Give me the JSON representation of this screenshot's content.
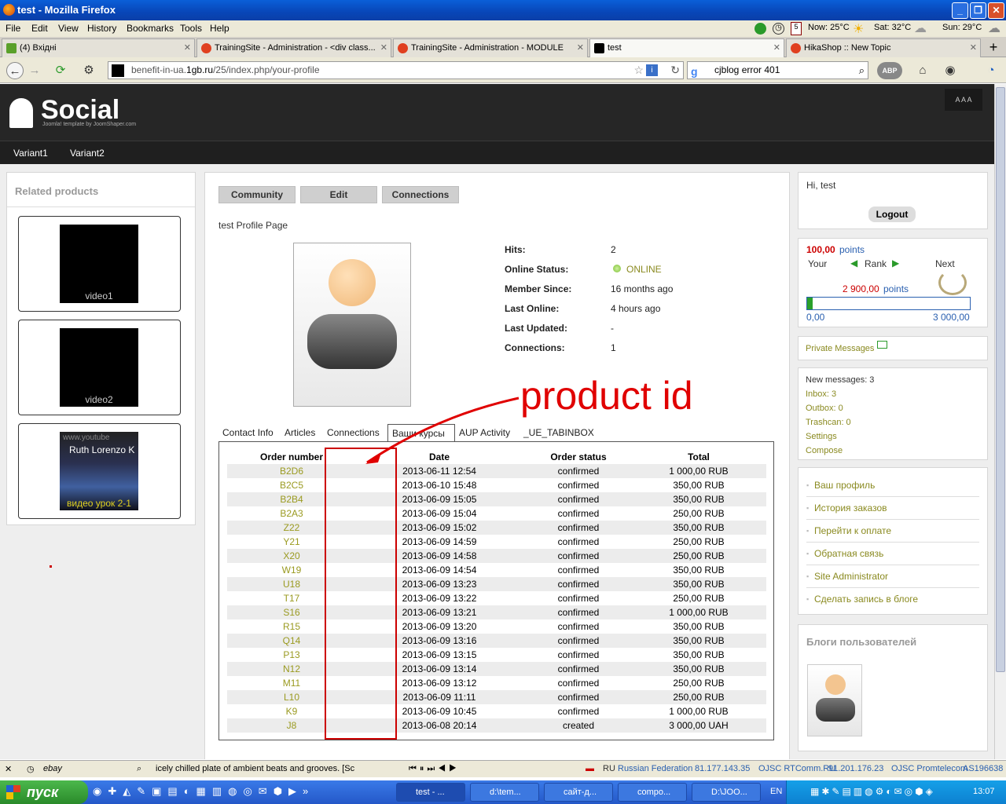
{
  "window": {
    "title": "test - Mozilla Firefox"
  },
  "menubar": {
    "items": [
      "File",
      "Edit",
      "View",
      "History",
      "Bookmarks",
      "Tools",
      "Help"
    ],
    "weather": {
      "now": "Now: 25°C",
      "sat": "Sat: 32°C",
      "sun": "Sun: 29°C",
      "date_badge": "5"
    }
  },
  "tabs": [
    {
      "label": "(4) Вхідні"
    },
    {
      "label": "TrainingSite - Administration - <div class..."
    },
    {
      "label": "TrainingSite - Administration - MODULE"
    },
    {
      "label": "test"
    },
    {
      "label": "HikaShop :: New Topic"
    }
  ],
  "navbar": {
    "url_prefix": "benefit-in-ua.",
    "url_host": "1gb.ru",
    "url_path": "/25/index.php/your-profile",
    "search_value": "cjblog error 401"
  },
  "site": {
    "logo": "Social",
    "logo_sub": "Joomla! template by JoomShaper.com",
    "font_sizes": "A A A",
    "nav": [
      "Variant1",
      "Variant2"
    ]
  },
  "related": {
    "title": "Related products",
    "items": [
      "video1",
      "video2",
      "видео урок 2-1"
    ],
    "video3_caption": "Ruth Lorenzo K",
    "video3_watermark": "www.youtube"
  },
  "profile": {
    "buttons": [
      "Community",
      "Edit",
      "Connections"
    ],
    "page_title": "test Profile Page",
    "info": [
      {
        "label": "Hits:",
        "value": "2"
      },
      {
        "label": "Online Status:",
        "value": "ONLINE"
      },
      {
        "label": "Member Since:",
        "value": "16 months ago"
      },
      {
        "label": "Last Online:",
        "value": "4 hours ago"
      },
      {
        "label": "Last Updated:",
        "value": "-"
      },
      {
        "label": "Connections:",
        "value": "1"
      }
    ],
    "tabs": [
      "Contact Info",
      "Articles",
      "Connections",
      "Ваши курсы",
      "AUP Activity",
      "_UE_TABINBOX"
    ]
  },
  "orders": {
    "headers": [
      "Order number",
      "Date",
      "Order status",
      "Total"
    ],
    "rows": [
      [
        "B2D6",
        "2013-06-11 12:54",
        "confirmed",
        "1 000,00 RUB"
      ],
      [
        "B2C5",
        "2013-06-10 15:48",
        "confirmed",
        "350,00 RUB"
      ],
      [
        "B2B4",
        "2013-06-09 15:05",
        "confirmed",
        "350,00 RUB"
      ],
      [
        "B2A3",
        "2013-06-09 15:04",
        "confirmed",
        "250,00 RUB"
      ],
      [
        "Z22",
        "2013-06-09 15:02",
        "confirmed",
        "350,00 RUB"
      ],
      [
        "Y21",
        "2013-06-09 14:59",
        "confirmed",
        "250,00 RUB"
      ],
      [
        "X20",
        "2013-06-09 14:58",
        "confirmed",
        "250,00 RUB"
      ],
      [
        "W19",
        "2013-06-09 14:54",
        "confirmed",
        "350,00 RUB"
      ],
      [
        "U18",
        "2013-06-09 13:23",
        "confirmed",
        "350,00 RUB"
      ],
      [
        "T17",
        "2013-06-09 13:22",
        "confirmed",
        "250,00 RUB"
      ],
      [
        "S16",
        "2013-06-09 13:21",
        "confirmed",
        "1 000,00 RUB"
      ],
      [
        "R15",
        "2013-06-09 13:20",
        "confirmed",
        "350,00 RUB"
      ],
      [
        "Q14",
        "2013-06-09 13:16",
        "confirmed",
        "350,00 RUB"
      ],
      [
        "P13",
        "2013-06-09 13:15",
        "confirmed",
        "350,00 RUB"
      ],
      [
        "N12",
        "2013-06-09 13:14",
        "confirmed",
        "350,00 RUB"
      ],
      [
        "M11",
        "2013-06-09 13:12",
        "confirmed",
        "250,00 RUB"
      ],
      [
        "L10",
        "2013-06-09 11:11",
        "confirmed",
        "250,00 RUB"
      ],
      [
        "K9",
        "2013-06-09 10:45",
        "confirmed",
        "1 000,00 RUB"
      ],
      [
        "J8",
        "2013-06-08 20:14",
        "created",
        "3 000,00 UAH"
      ]
    ]
  },
  "annotation": {
    "text": "product id",
    "color": "#e00000"
  },
  "sidebar": {
    "greeting": "Hi, test",
    "logout": "Logout",
    "points": {
      "value": "100,00",
      "unit": "points",
      "your": "Your",
      "rank": "Rank",
      "next": "Next",
      "next_points": "2 900,00",
      "progress_min": "0,00",
      "progress_max": "3 000,00",
      "progress_fraction": 0.033
    },
    "private_messages": "Private Messages",
    "messages": [
      "New messages: 3",
      "Inbox: 3",
      "Outbox: 0",
      "Trashcan: 0",
      "Settings",
      "Compose"
    ],
    "menu": [
      "Ваш профиль",
      "История заказов",
      "Перейти к оплате",
      "Обратная связь",
      "Site Administrator",
      "Сделать запись в блоге"
    ],
    "blogs_title": "Блоги пользователей"
  },
  "statusbar": {
    "ticker": "icely chilled plate of ambient beats and grooves. [Sc",
    "lang": "RU",
    "country": "Russian Federation",
    "ip1": "81.177.143.35",
    "isp1": "OJSC RTComm.RU",
    "ip2": "91.201.176.23",
    "isp2": "OJSC Promtelecom",
    "as": "AS196638",
    "ebay": "ebay"
  },
  "taskbar": {
    "start": "пуск",
    "tasks": [
      "test - ...",
      "d:\\tem...",
      "сайт-д...",
      "compo...",
      "D:\\JOO..."
    ],
    "lang": "EN",
    "clock": "13:07"
  }
}
